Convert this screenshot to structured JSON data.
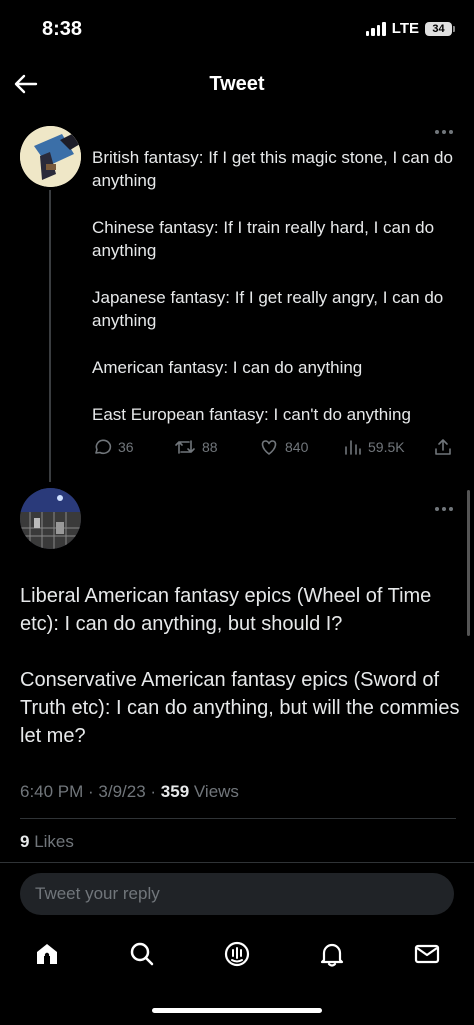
{
  "status_bar": {
    "time": "8:38",
    "network": "LTE",
    "battery": "34"
  },
  "header": {
    "title": "Tweet",
    "back_icon": "arrow-left-icon"
  },
  "parent_tweet": {
    "lines": [
      "British fantasy: If I get this magic stone, I can do anything",
      "Chinese fantasy: If I train really hard, I can do anything",
      "Japanese fantasy: If I get really angry, I can do anything",
      "American fantasy: I can do anything",
      "East European fantasy: I can't do anything"
    ],
    "replies": "36",
    "retweets": "88",
    "likes": "840",
    "views": "59.5K"
  },
  "main_tweet": {
    "paragraphs": [
      "Liberal American fantasy epics (Wheel of Time etc): I can do anything, but should I?",
      "Conservative American fantasy epics (Sword of Truth etc): I can do anything, but will the commies let me?"
    ],
    "timestamp": "6:40 PM · 3/9/23 · ",
    "views_count": "359",
    "views_label": " Views",
    "likes_count": "9",
    "likes_label": " Likes"
  },
  "reply": {
    "placeholder": "Tweet your reply"
  },
  "nav": {
    "items": [
      "home-icon",
      "search-icon",
      "spaces-icon",
      "notifications-icon",
      "messages-icon"
    ]
  },
  "colors": {
    "background": "#000000",
    "text": "#e7e9ea",
    "muted": "#71767b",
    "divider": "#2f3336"
  }
}
